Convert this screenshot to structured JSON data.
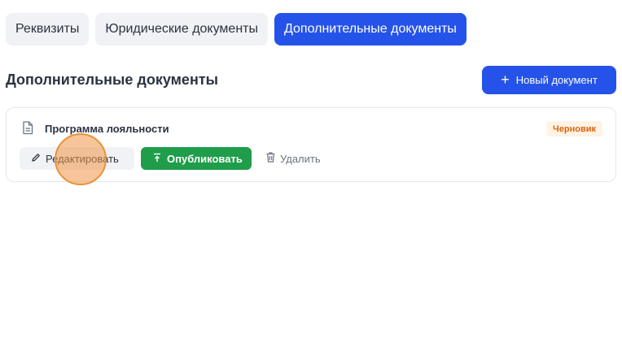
{
  "tabs": [
    {
      "label": "Реквизиты",
      "active": false
    },
    {
      "label": "Юридические документы",
      "active": false
    },
    {
      "label": "Дополнительные документы",
      "active": true
    }
  ],
  "section": {
    "title": "Дополнительные документы",
    "new_document_button": "Новый документ"
  },
  "documents": [
    {
      "title": "Программа лояльности",
      "status": "Черновик",
      "actions": {
        "edit": "Редактировать",
        "publish": "Опубликовать",
        "delete": "Удалить"
      }
    }
  ],
  "colors": {
    "accent": "#2553ea",
    "publish": "#1f9d4a",
    "draft_badge_text": "#d9640a",
    "draft_badge_bg": "#fff3e6"
  },
  "icons": {
    "new_document": "plus-icon",
    "document": "document-icon",
    "edit": "pencil-icon",
    "publish": "upload-icon",
    "delete": "trash-icon"
  }
}
